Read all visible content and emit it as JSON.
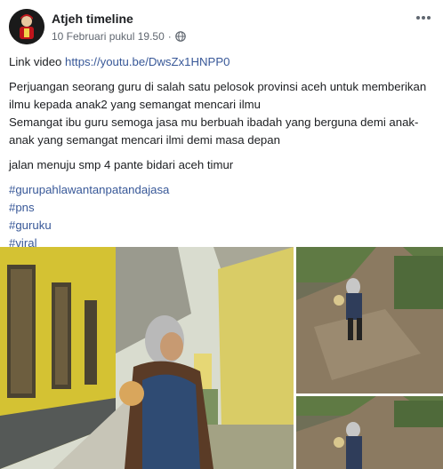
{
  "post": {
    "author": "Atjeh timeline",
    "timestamp": "10 Februari pukul 19.50",
    "separator": "·",
    "privacy_icon": "globe-icon",
    "more_icon": "more-options-icon"
  },
  "content": {
    "link_prefix": "Link video ",
    "link_url": "https://youtu.be/DwsZx1HNPP0",
    "paragraph1": "Perjuangan seorang guru di salah satu pelosok provinsi aceh untuk memberikan ilmu kepada anak2 yang semangat mencari ilmu",
    "paragraph2": "Semangat ibu guru semoga jasa mu berbuah ibadah yang berguna demi anak-anak yang semangat mencari ilmi demi masa depan",
    "paragraph3": "jalan menuju smp 4 pante bidari aceh timur",
    "hashtags": [
      "#gurupahlawantanpatandajasa",
      "#pns",
      "#guruku",
      "#viral"
    ]
  },
  "colors": {
    "link": "#385898",
    "text": "#1c1e21",
    "meta": "#606770"
  }
}
